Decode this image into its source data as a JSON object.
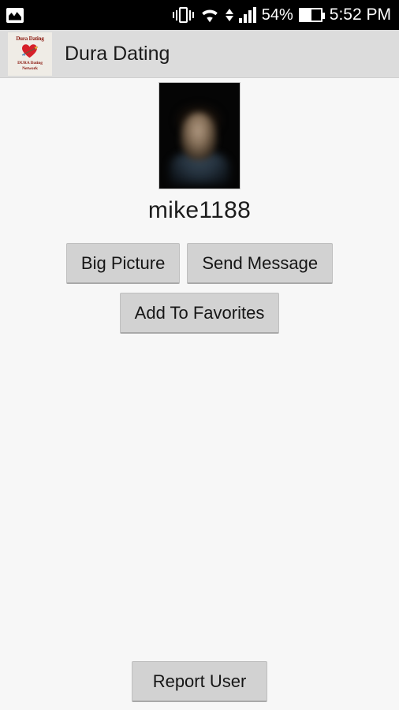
{
  "status_bar": {
    "notification_icon": "gallery-icon",
    "vibrate_icon": "vibrate-icon",
    "wifi_icon": "wifi-icon",
    "data-transfer_icon": "data-arrows-icon",
    "signal_icon": "signal-bars-icon",
    "battery_percent": "54%",
    "battery_level": 54,
    "battery_icon": "battery-icon",
    "time": "5:52 PM",
    "background_color": "#000000",
    "text_color": "#ffffff"
  },
  "app_bar": {
    "logo": {
      "icon_name": "dura-dating-logo",
      "top_text": "Dura Dating",
      "bottom_text_line1": "DURA Dating",
      "bottom_text_line2": "Network",
      "heart_color": "#d6202a",
      "text_color": "#8b1a10"
    },
    "title": "Dura Dating",
    "background_color": "#dcdcdc"
  },
  "profile": {
    "photo_alt": "profile-photo",
    "username": "mike1188"
  },
  "actions": {
    "big_picture": "Big Picture",
    "send_message": "Send Message",
    "add_to_favorites": "Add To Favorites",
    "report_user": "Report User",
    "button_color": "#d2d2d2"
  },
  "theme": {
    "page_background": "#f7f7f7",
    "text_color": "#1c1c1c"
  }
}
